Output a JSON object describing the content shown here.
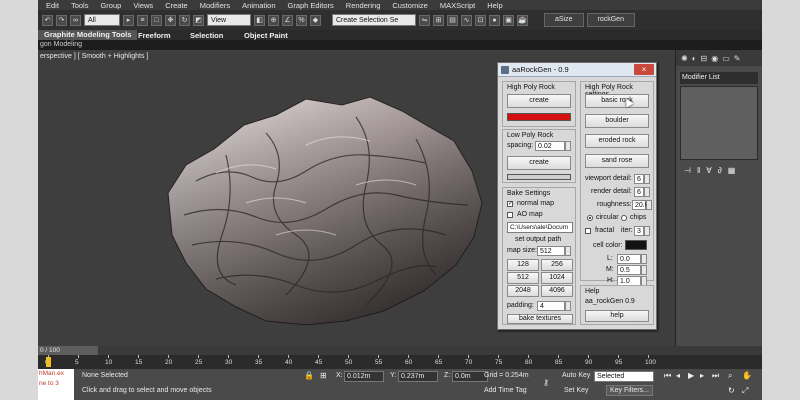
{
  "menu": [
    "Edit",
    "Tools",
    "Group",
    "Views",
    "Create",
    "Modifiers",
    "Animation",
    "Graph Editors",
    "Rendering",
    "Customize",
    "MAXScript",
    "Help"
  ],
  "toolbar": {
    "selection_filter": "All",
    "ref_coord": "View",
    "named_selection_placeholder": "Create Selection Se",
    "buttons": [
      "aSize",
      "rockGen"
    ]
  },
  "ribbon": {
    "tabs": [
      "Graphite Modeling Tools",
      "Freeform",
      "Selection",
      "Object Paint"
    ],
    "subtab": "gon Modeling"
  },
  "viewport": {
    "label": "erspective ] [ Smooth + Highlights ]"
  },
  "command_panel": {
    "modifier_list": "Modifier List"
  },
  "dialog": {
    "title": "aaRockGen - 0.9",
    "high_poly": {
      "title": "High Poly Rock",
      "create": "create",
      "color": "#d41010"
    },
    "low_poly": {
      "title": "Low Poly Rock",
      "spacing_label": "spacing:",
      "spacing_value": "0.02",
      "create": "create"
    },
    "bake": {
      "title": "Bake Settings",
      "normal_map": "normal map",
      "ao_map": "AO map",
      "path": "C:\\Users\\ale\\Docum",
      "set_output_path": "set output path",
      "map_size_label": "map size:",
      "map_size_value": "512",
      "sizes": [
        "128",
        "256",
        "512",
        "1024",
        "2048",
        "4096"
      ],
      "padding_label": "padding:",
      "padding_value": "4",
      "bake_textures": "bake textures"
    },
    "settings": {
      "title": "High Poly Rock settings",
      "buttons": [
        "basic rock",
        "boulder",
        "eroded rock",
        "sand rose"
      ],
      "viewport_detail_label": "viewport detail:",
      "viewport_detail_value": "6",
      "render_detail_label": "render detail:",
      "render_detail_value": "6",
      "roughness_label": "roughness:",
      "roughness_value": "20.0",
      "circular": "circular",
      "chips": "chips",
      "fractal": "fractal",
      "iter_label": "iter:",
      "iter_value": "3",
      "cell_color_label": "cell color:",
      "cell_color": "#111111",
      "l_label": "L:",
      "l_value": "0.0",
      "m_label": "M:",
      "m_value": "0.5",
      "h_label": "H:",
      "h_value": "1.0"
    },
    "help": {
      "title": "Help",
      "version": "aa_rockGen 0.9",
      "button": "help"
    }
  },
  "timeline": {
    "slider_text": "0 / 100",
    "ticks": [
      "0",
      "5",
      "10",
      "15",
      "20",
      "25",
      "30",
      "35",
      "40",
      "45",
      "50",
      "55",
      "60",
      "65",
      "70",
      "75",
      "80",
      "85",
      "90",
      "95",
      "100"
    ]
  },
  "status": {
    "script_line1": "hMan.ex",
    "script_line2": "ne to 3",
    "selected": "None Selected",
    "prompt": "Click and drag to select and move objects",
    "x_label": "X:",
    "x_value": "0.012m",
    "y_label": "Y:",
    "y_value": "0.237m",
    "z_label": "Z:",
    "z_value": "0.0m",
    "grid": "Grid = 0.254m",
    "add_time_tag": "Add Time Tag",
    "auto_key": "Auto Key",
    "auto_key_value": "Selected",
    "set_key": "Set Key",
    "key_filters": "Key Filters..."
  }
}
